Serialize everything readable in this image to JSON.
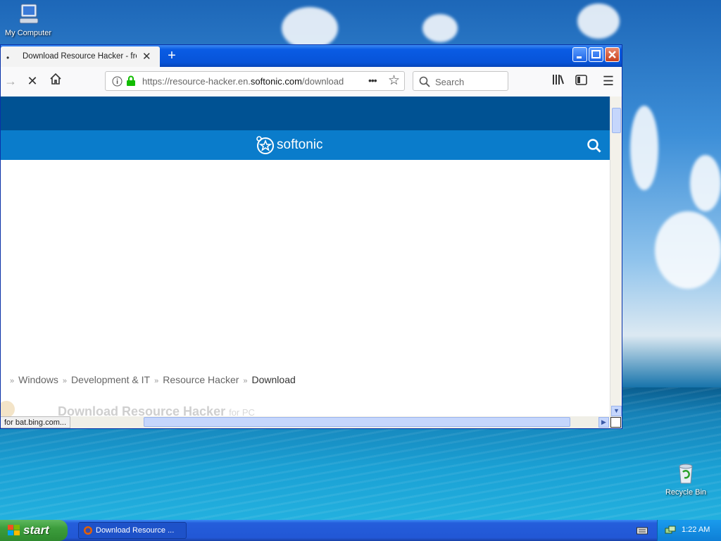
{
  "desktop": {
    "icons": [
      {
        "label": "My Computer",
        "icon": "computer-icon"
      },
      {
        "label": "Recycle Bin",
        "icon": "recycle-bin-icon"
      }
    ]
  },
  "browser": {
    "tab": {
      "title": "Download Resource Hacker - free",
      "close": "✕",
      "dot": "•"
    },
    "new_tab": "+",
    "window_buttons": {
      "minimize": "_",
      "maximize": "□",
      "close": "✕"
    },
    "nav": {
      "forward": "→",
      "stop": "✕",
      "home": "⌂"
    },
    "url": {
      "prefix": "https://resource-hacker.en.",
      "domain": "softonic.com",
      "path": "/download"
    },
    "page_actions": "•••",
    "bookmark_star": "☆",
    "search": {
      "placeholder": "Search"
    },
    "menu_icon": "☰",
    "status_text": "for bat.bing.com..."
  },
  "page": {
    "logo_text": "softonic",
    "breadcrumb": [
      {
        "label": "Windows"
      },
      {
        "label": "Development & IT"
      },
      {
        "label": "Resource Hacker"
      },
      {
        "label": "Download"
      }
    ],
    "breadcrumb_sep": "»",
    "title": "Download Resource Hacker",
    "title_suffix": "for PC"
  },
  "taskbar": {
    "start_label": "start",
    "task_label": "Download Resource ...",
    "clock": "1:22 AM"
  },
  "colors": {
    "softonic_dark": "#005293",
    "softonic_blue": "#0a7ccb",
    "xp_blue": "#0a58e0",
    "start_green": "#3c9d3c"
  }
}
